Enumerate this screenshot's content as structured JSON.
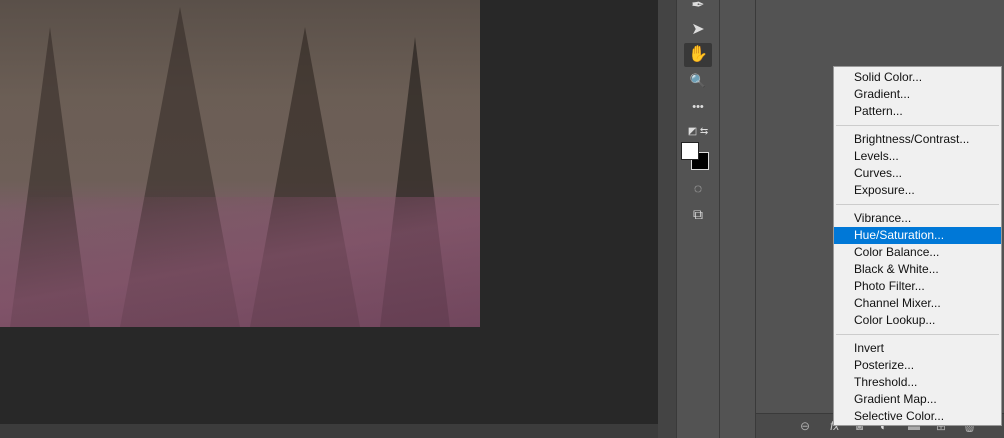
{
  "tools": [
    {
      "name": "pen-tool",
      "glyph": "✒"
    },
    {
      "name": "path-selection-tool",
      "glyph": "➤"
    },
    {
      "name": "hand-tool",
      "glyph": "✋"
    },
    {
      "name": "zoom-tool",
      "glyph": "🔍"
    },
    {
      "name": "edit-toolbar",
      "glyph": "•••"
    },
    {
      "name": "quick-mask",
      "glyph": "◌"
    },
    {
      "name": "screen-mode",
      "glyph": "⧉"
    }
  ],
  "colors": {
    "foreground": "#ffffff",
    "background": "#000000",
    "highlight": "#0078d7"
  },
  "menu": {
    "groups": [
      [
        "Solid Color...",
        "Gradient...",
        "Pattern..."
      ],
      [
        "Brightness/Contrast...",
        "Levels...",
        "Curves...",
        "Exposure..."
      ],
      [
        "Vibrance...",
        "Hue/Saturation...",
        "Color Balance...",
        "Black & White...",
        "Photo Filter...",
        "Channel Mixer...",
        "Color Lookup..."
      ],
      [
        "Invert",
        "Posterize...",
        "Threshold...",
        "Gradient Map...",
        "Selective Color..."
      ]
    ],
    "selected": "Hue/Saturation..."
  },
  "layers_bar": {
    "fx_label": "fx"
  }
}
